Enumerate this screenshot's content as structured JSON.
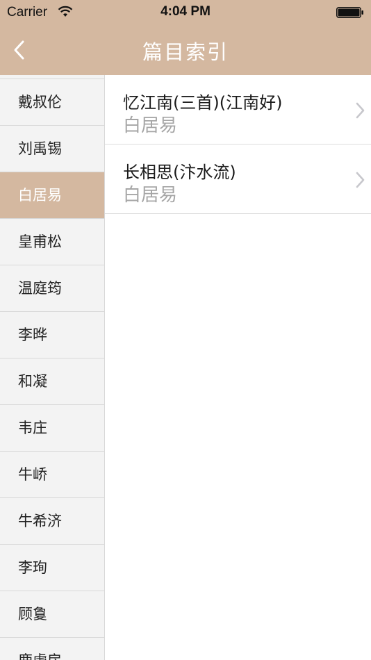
{
  "status_bar": {
    "carrier": "Carrier",
    "time": "4:04 PM"
  },
  "nav": {
    "title": "篇目索引"
  },
  "sidebar": {
    "items": [
      {
        "label": "戴叔伦"
      },
      {
        "label": "刘禹锡"
      },
      {
        "label": "白居易",
        "selected": true
      },
      {
        "label": "皇甫松"
      },
      {
        "label": "温庭筠"
      },
      {
        "label": "李晔"
      },
      {
        "label": "和凝"
      },
      {
        "label": "韦庄"
      },
      {
        "label": "牛峤"
      },
      {
        "label": "牛希济"
      },
      {
        "label": "李珣"
      },
      {
        "label": "顾敻"
      },
      {
        "label": "鹿虔扆"
      }
    ]
  },
  "poems": [
    {
      "title": "忆江南(三首)(江南好)",
      "author": "白居易"
    },
    {
      "title": "长相思(汴水流)",
      "author": "白居易"
    }
  ],
  "colors": {
    "accent": "#d4b8a0",
    "sidebar_bg": "#f3f3f3",
    "subtitle_gray": "#a6a6a6"
  },
  "icons": {
    "back": "chevron-left-icon",
    "row": "chevron-right-icon",
    "wifi": "wifi-icon",
    "battery": "battery-icon"
  }
}
